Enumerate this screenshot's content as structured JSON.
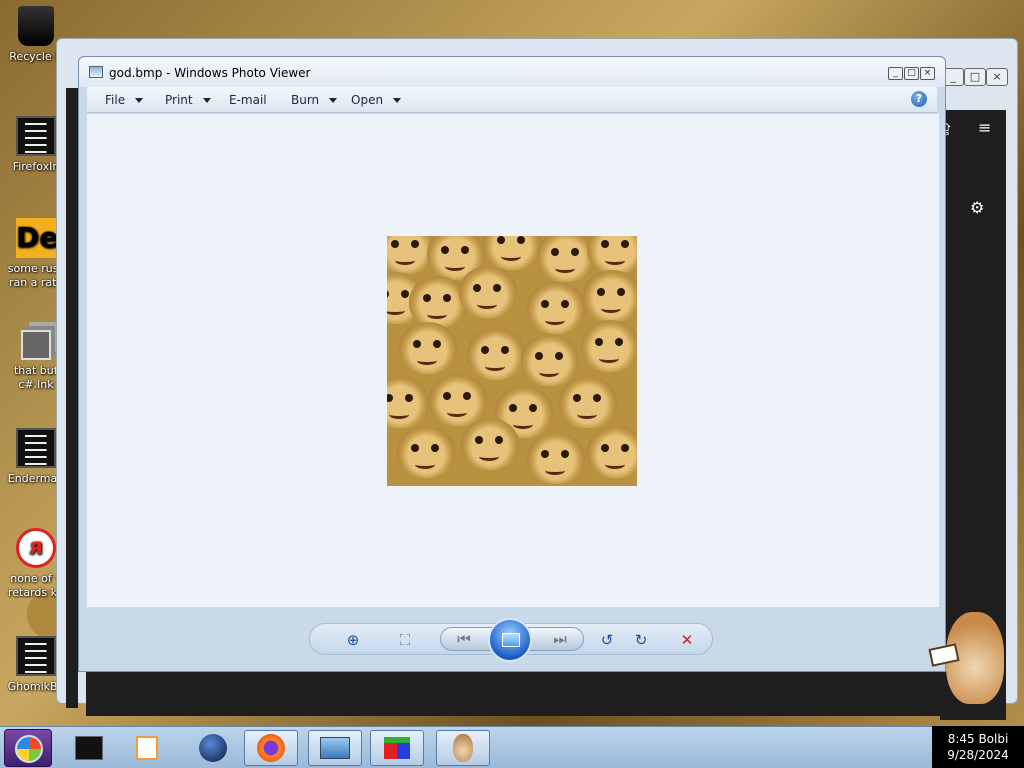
{
  "desktop": {
    "icons": [
      {
        "label": "Recycle B",
        "icon": "recycle-bin-icon"
      },
      {
        "label": "FirefoxIn",
        "icon": "shortcut-icon"
      },
      {
        "label": "some russ ran a rat.l",
        "icon": "dex-icon"
      },
      {
        "label": "that but c#.lnk",
        "icon": "stack-icon"
      },
      {
        "label": "Enderman",
        "icon": "shortcut-icon"
      },
      {
        "label": "none of y retards kn",
        "icon": "dino-icon"
      },
      {
        "label": "GhomikBo",
        "icon": "shortcut-icon"
      }
    ]
  },
  "photo_viewer": {
    "title": "god.bmp - Windows Photo Viewer",
    "menu": [
      {
        "label": "File",
        "dropdown": true
      },
      {
        "label": "Print",
        "dropdown": true
      },
      {
        "label": "E-mail",
        "dropdown": false
      },
      {
        "label": "Burn",
        "dropdown": true
      },
      {
        "label": "Open",
        "dropdown": true
      }
    ],
    "help_glyph": "?",
    "toolbar": {
      "zoom_glyph": "⊕",
      "fit_glyph": "⛶",
      "prev_glyph": "⏮",
      "next_glyph": "⏭",
      "rotate_ccw_glyph": "↺",
      "rotate_cw_glyph": "↻",
      "delete_glyph": "✕"
    }
  },
  "window_buttons": {
    "minimize": "_",
    "maximize": "□",
    "close": "×"
  },
  "tray": {
    "time": "8:45 Bolbi",
    "date": "9/28/2024"
  },
  "colors": {
    "accent": "#1d5fb8",
    "delete": "#cc2222",
    "canvas": "#eef3fa"
  }
}
